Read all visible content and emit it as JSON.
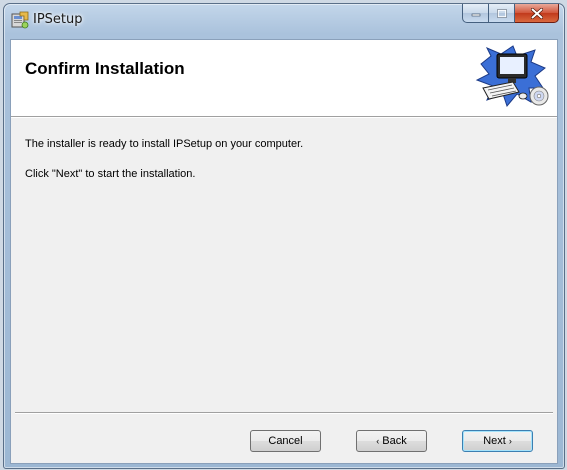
{
  "window": {
    "title": "IPSetup",
    "caption_buttons": [
      "minimize",
      "maximize",
      "close"
    ],
    "accent_close": "#c1391c"
  },
  "header": {
    "title": "Confirm Installation",
    "graphic_icon": "computer-setup-icon"
  },
  "body": {
    "line1": "The installer is ready to install IPSetup on your computer.",
    "line2": "Click \"Next\" to start the installation."
  },
  "buttons": {
    "cancel": "Cancel",
    "back_arrow": "‹",
    "back": "Back",
    "next": "Next",
    "next_arrow": "›"
  }
}
